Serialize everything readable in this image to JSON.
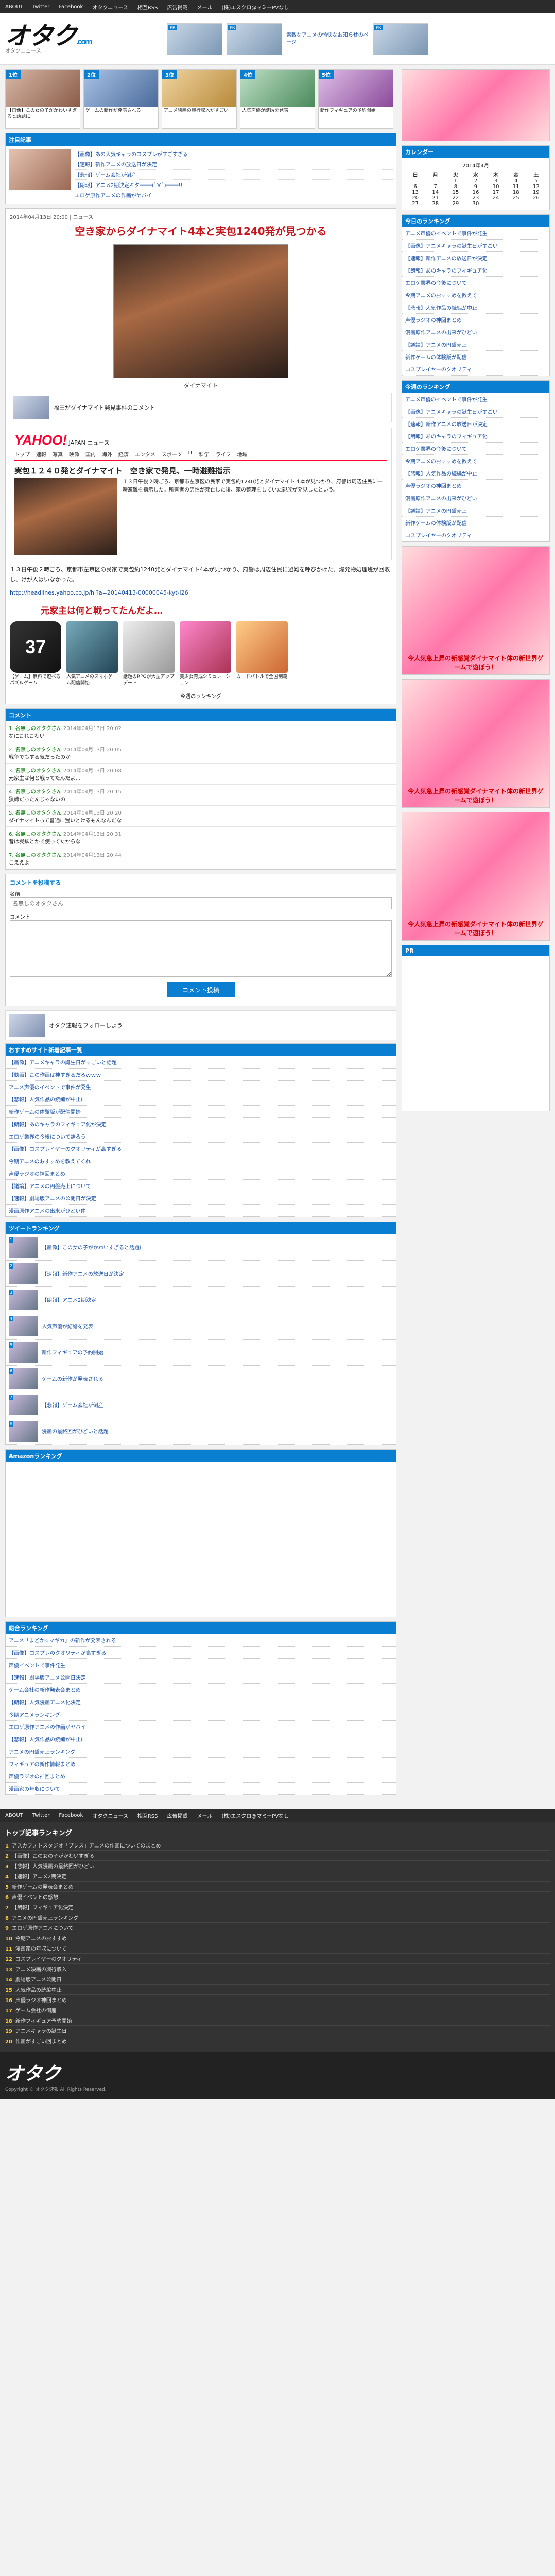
{
  "topbar": [
    "ABOUT",
    "Twitter",
    "Facebook",
    "オタクニュース",
    "相互RSS",
    "広告掲載",
    "メール",
    "(株)エスクロ@マミーPVなし"
  ],
  "header": {
    "logo": "オタク",
    "logo_suffix": ".com",
    "logo_sub": "オタクニュース",
    "ad_text": "素敵なアニメの愉快なお知らせのページ"
  },
  "rank_strip": [
    {
      "no": "1位",
      "text": "【画像】この女の子がかわいすぎると話題に"
    },
    {
      "no": "2位",
      "text": "ゲームの新作が発表される"
    },
    {
      "no": "3位",
      "text": "アニメ映画の興行収入がすごい"
    },
    {
      "no": "4位",
      "text": "人気声優が結婚を発表"
    },
    {
      "no": "5位",
      "text": "新作フィギュアの予約開始"
    }
  ],
  "pickup": {
    "head": "注目記事",
    "items": [
      "【画像】あの人気キャラのコスプレがすごすぎる",
      "【速報】新作アニメの放送日が決定",
      "【悲報】ゲーム会社が倒産",
      "【朗報】アニメ2期決定キタ━━━━(ﾟ∀ﾟ)━━━━!!",
      "エロゲ原作アニメの作画がヤバイ"
    ]
  },
  "article": {
    "date": "2014年04月13日 20:00",
    "category": "ニュース",
    "title": "空き家からダイナマイト4本と実包1240発が見つかる",
    "caption": "ダイナマイト",
    "pr_text": "福田がダイナマイト発見事件のコメント",
    "yahoo": {
      "logo": "YAHOO!",
      "sub": "JAPAN ニュース",
      "nav": [
        "トップ",
        "速報",
        "写真",
        "映像",
        "国内",
        "海外",
        "経済",
        "エンタメ",
        "スポーツ",
        "IT",
        "科学",
        "ライフ",
        "地域"
      ],
      "title": "実包１２４０発とダイナマイト　空き家で発見、一時避難指示",
      "body": "１３日午後２時ごろ、京都市左京区の民家で実包約1240発とダイナマイト４本が見つかり、府警は周辺住民に一時避難を指示した。所有者の男性が死亡した後、家の整理をしていた親族が発見したという。"
    },
    "body": "１３日午後２時ごろ、京都市左京区の民家で実包約1240発とダイナマイト4本が見つかり、府警は周辺住民に避難を呼びかけた。爆発物処理班が回収し、けが人はいなかった。",
    "link": "http://headlines.yahoo.co.jp/hl?a=20140413-00000045-kyt-l26"
  },
  "ad_title": "元家主は何と戦ってたんだよ…",
  "apps": [
    {
      "icon": "37",
      "text": "【ゲーム】無料で遊べるパズルゲーム"
    },
    {
      "icon": "",
      "text": "人気アニメのスマホゲーム配信開始"
    },
    {
      "icon": "",
      "text": "話題のRPGが大型アップデート"
    },
    {
      "icon": "",
      "text": "美少女育成シミュレーション"
    },
    {
      "icon": "",
      "text": "カードバトルで全国制覇"
    }
  ],
  "rank_label": "今週のランキング",
  "comments_head": "コメント",
  "comments": [
    {
      "who": "1. 名無しのオタクさん",
      "time": "2014年04月13日 20:02",
      "text": "なにこれこわい"
    },
    {
      "who": "2. 名無しのオタクさん",
      "time": "2014年04月13日 20:05",
      "text": "戦争でもする気だったのか"
    },
    {
      "who": "3. 名無しのオタクさん",
      "time": "2014年04月13日 20:08",
      "text": "元家主は何と戦ってたんだよ…"
    },
    {
      "who": "4. 名無しのオタクさん",
      "time": "2014年04月13日 20:15",
      "text": "猟師だったんじゃないの"
    },
    {
      "who": "5. 名無しのオタクさん",
      "time": "2014年04月13日 20:20",
      "text": "ダイナマイトって普通に置いとけるもんなんだな"
    },
    {
      "who": "6. 名無しのオタクさん",
      "time": "2014年04月13日 20:31",
      "text": "昔は炭鉱とかで使ってたからな"
    },
    {
      "who": "7. 名無しのオタクさん",
      "time": "2014年04月13日 20:44",
      "text": "こええよ"
    }
  ],
  "form": {
    "head": "コメントを投稿する",
    "name_label": "名前",
    "name_placeholder": "名無しのオタクさん",
    "body_label": "コメント",
    "submit": "コメント投稿"
  },
  "share_text": "オタク速報をフォローしよう",
  "recommend": {
    "head": "おすすめサイト新着記事一覧",
    "items": [
      "【画像】アニメキャラの誕生日がすごいと話題",
      "【動画】この作画は神すぎるだろｗｗｗ",
      "アニメ声優のイベントで事件が発生",
      "【悲報】人気作品の続編が中止に",
      "新作ゲームの体験版が配信開始",
      "【朗報】あのキャラのフィギュア化が決定",
      "エロゲ業界の今後について語ろう",
      "【画像】コスプレイヤーのクオリティが高すぎる",
      "今期アニメのおすすめを教えてくれ",
      "声優ラジオの神回まとめ",
      "【議論】アニメの円盤売上について",
      "【速報】劇場版アニメの公開日が決定",
      "漫画原作アニメの出来がひどい件"
    ]
  },
  "ranking2": {
    "head": "ツイートランキング",
    "items": [
      "【画像】この女の子がかわいすぎると話題に",
      "【速報】新作アニメの放送日が決定",
      "【朗報】アニメ2期決定",
      "人気声優が結婚を発表",
      "新作フィギュアの予約開始",
      "ゲームの新作が発表される",
      "【悲報】ゲーム会社が倒産",
      "漫画の最終回がひどいと話題"
    ]
  },
  "amazon_head": "Amazonランキング",
  "ranking3": {
    "head": "総合ランキング",
    "items": [
      "アニメ「まどか☆マギカ」の新作が発表される",
      "【画像】コスプレのクオリティが高すぎる",
      "声優イベントで事件発生",
      "【速報】劇場版アニメ公開日決定",
      "ゲーム会社の新作発表会まとめ",
      "【朗報】人気漫画アニメ化決定",
      "今期アニメランキング",
      "エロゲ原作アニメの作画がヤバイ",
      "【悲報】人気作品の続編が中止に",
      "アニメの円盤売上ランキング",
      "フィギュアの新作情報まとめ",
      "声優ラジオの神回まとめ",
      "漫画家の年収について"
    ]
  },
  "sidebar": {
    "calendar_head": "カレンダー",
    "calendar_caption": "2014年4月",
    "days": [
      "日",
      "月",
      "火",
      "水",
      "木",
      "金",
      "土"
    ],
    "weeks": [
      [
        "",
        "",
        "1",
        "2",
        "3",
        "4",
        "5"
      ],
      [
        "6",
        "7",
        "8",
        "9",
        "10",
        "11",
        "12"
      ],
      [
        "13",
        "14",
        "15",
        "16",
        "17",
        "18",
        "19"
      ],
      [
        "20",
        "21",
        "22",
        "23",
        "24",
        "25",
        "26"
      ],
      [
        "27",
        "28",
        "29",
        "30",
        "",
        "",
        ""
      ]
    ],
    "rank_head": "今日のランキング",
    "rank_items": [
      "アニメ声優のイベントで事件が発生",
      "【画像】アニメキャラの誕生日がすごい",
      "【速報】新作アニメの放送日が決定",
      "【朗報】あのキャラのフィギュア化",
      "エロゲ業界の今後について",
      "今期アニメのおすすめを教えて",
      "【悲報】人気作品の続編が中止",
      "声優ラジオの神回まとめ",
      "漫画原作アニメの出来がひどい",
      "【議論】アニメの円盤売上",
      "新作ゲームの体験版が配信",
      "コスプレイヤーのクオリティ"
    ],
    "week_head": "今週のランキング",
    "ad_text": "今人気急上昇の新感覚ダイナマイト体の新世界ゲームで遊ぼう！",
    "pr_head": "PR"
  },
  "footer": {
    "rank_head": "トップ記事ランキング",
    "items": [
      "アスカフォトスタジオ「ブレス」アニメの作画についてのまとめ",
      "【画像】この女の子がかわいすぎる",
      "【悲報】人気漫画の最終回がひどい",
      "【速報】アニメ2期決定",
      "新作ゲームの発表会まとめ",
      "声優イベントの感想",
      "【朗報】フィギュア化決定",
      "アニメの円盤売上ランキング",
      "エロゲ原作アニメについて",
      "今期アニメのおすすめ",
      "漫画家の年収について",
      "コスプレイヤーのクオリティ",
      "アニメ映画の興行収入",
      "劇場版アニメ公開日",
      "人気作品の続編中止",
      "声優ラジオ神回まとめ",
      "ゲーム会社の倒産",
      "新作フィギュア予約開始",
      "アニメキャラの誕生日",
      "作画がすごい回まとめ"
    ],
    "logo": "オタク",
    "copy": "Copyright © オタク速報 All Rights Reserved."
  }
}
